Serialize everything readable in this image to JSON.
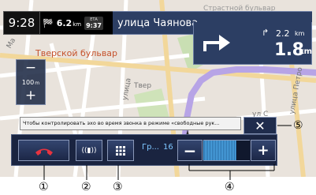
{
  "status": {
    "time": "9:28",
    "destination_distance": "6.2",
    "destination_distance_unit": "km",
    "eta_label": "ЕТА",
    "eta_time": "9:37",
    "street_name": "улица Чаянова"
  },
  "guidance": {
    "next_turn_distance": "2.2",
    "next_turn_unit": "km",
    "main_distance": "1.8",
    "main_unit": "km",
    "turn_direction": "right"
  },
  "map": {
    "label_tverskoy": "Тверской бульвар",
    "label_ma": "Ма",
    "label_ulitsa": "улица",
    "label_tver": "Твер",
    "label_ulitsa_petro": "улица Петро",
    "label_strastnoy": "Страстной бульвар",
    "label_s": "ул С",
    "label_ul": "ул"
  },
  "zoom": {
    "minus": "−",
    "scale_value": "100",
    "scale_unit": "m",
    "plus": "+"
  },
  "call": {
    "message": "Чтобы контролировать эхо во время звонка в режиме «свободные рук...",
    "close_glyph": "✕",
    "handsfree_glyph": "((▮))",
    "volume_label": "Гр...",
    "volume_value": "16",
    "volume_level": 0.72,
    "vol_minus": "−",
    "vol_plus": "+"
  },
  "callouts": {
    "c1": "①",
    "c2": "②",
    "c3": "③",
    "c4": "④",
    "c5": "⑤"
  },
  "colors": {
    "panel_blue": "#2c3e63",
    "hangup_red": "#e8333f",
    "volume_accent": "#7ec6ff"
  }
}
